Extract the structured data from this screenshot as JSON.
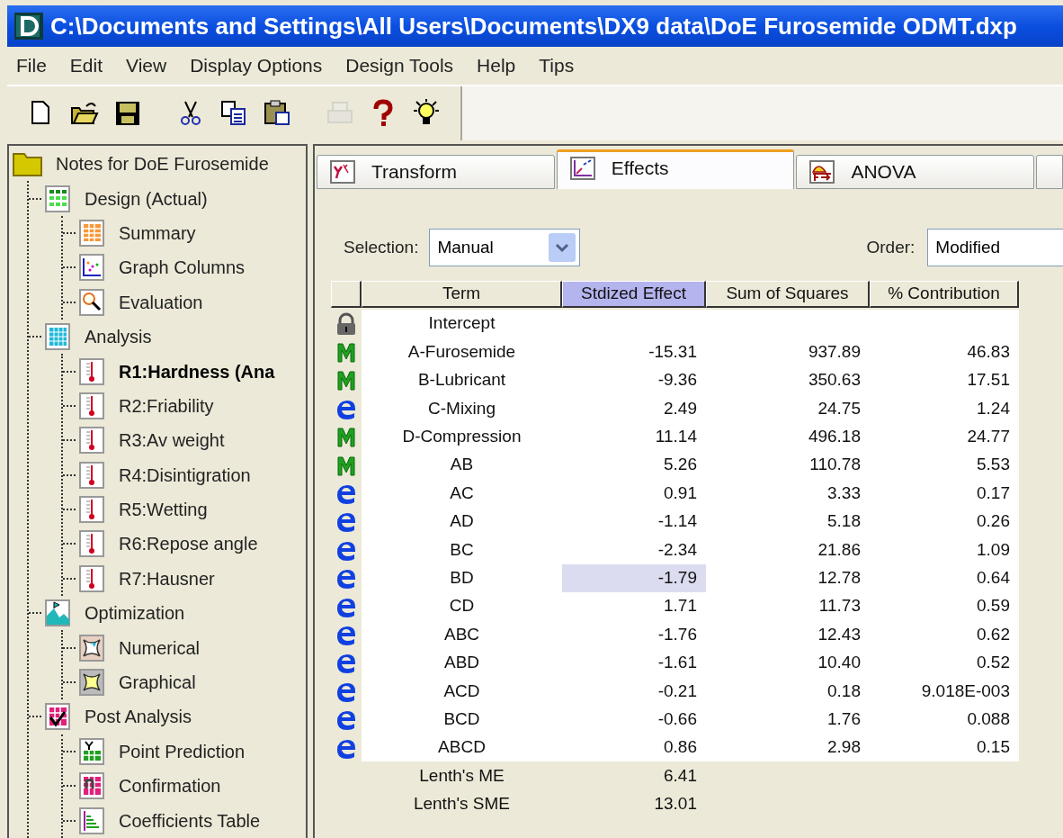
{
  "window": {
    "title": "C:\\Documents and Settings\\All Users\\Documents\\DX9 data\\DoE Furosemide ODMT.dxp"
  },
  "menu": [
    "File",
    "Edit",
    "View",
    "Display Options",
    "Design Tools",
    "Help",
    "Tips"
  ],
  "toolbar": [
    {
      "kind": "new",
      "disabled": false
    },
    {
      "kind": "open",
      "disabled": false
    },
    {
      "kind": "save",
      "disabled": false
    },
    {
      "kind": "sep"
    },
    {
      "kind": "cut",
      "disabled": false
    },
    {
      "kind": "copy",
      "disabled": false
    },
    {
      "kind": "paste",
      "disabled": false
    },
    {
      "kind": "sep"
    },
    {
      "kind": "print",
      "disabled": true
    },
    {
      "kind": "help",
      "disabled": false
    },
    {
      "kind": "tip",
      "disabled": false
    }
  ],
  "tree": [
    {
      "label": "Notes for DoE Furosemide",
      "kind": "folder",
      "selected": false,
      "children": [
        {
          "label": "Design (Actual)",
          "kind": "design",
          "selected": false,
          "children": [
            {
              "label": "Summary",
              "kind": "summary",
              "selected": false
            },
            {
              "label": "Graph Columns",
              "kind": "graph",
              "selected": false
            },
            {
              "label": "Evaluation",
              "kind": "evaluation",
              "selected": false
            }
          ]
        },
        {
          "label": "Analysis",
          "kind": "analysis",
          "selected": false,
          "children": [
            {
              "label": "R1:Hardness (Ana",
              "kind": "response",
              "selected": true
            },
            {
              "label": "R2:Friability",
              "kind": "response",
              "selected": false
            },
            {
              "label": "R3:Av weight",
              "kind": "response",
              "selected": false
            },
            {
              "label": "R4:Disintigration",
              "kind": "response",
              "selected": false
            },
            {
              "label": "R5:Wetting",
              "kind": "response",
              "selected": false
            },
            {
              "label": "R6:Repose angle",
              "kind": "response",
              "selected": false
            },
            {
              "label": "R7:Hausner",
              "kind": "response",
              "selected": false
            }
          ]
        },
        {
          "label": "Optimization",
          "kind": "optimization",
          "selected": false,
          "children": [
            {
              "label": "Numerical",
              "kind": "numerical",
              "selected": false
            },
            {
              "label": "Graphical",
              "kind": "graphical",
              "selected": false
            }
          ]
        },
        {
          "label": "Post Analysis",
          "kind": "post",
          "selected": false,
          "children": [
            {
              "label": "Point Prediction",
              "kind": "prediction",
              "selected": false
            },
            {
              "label": "Confirmation",
              "kind": "confirmation",
              "selected": false
            },
            {
              "label": "Coefficients Table",
              "kind": "coefficients",
              "selected": false
            }
          ]
        }
      ]
    }
  ],
  "tabs": [
    {
      "label": "Transform",
      "kind": "transform",
      "selected": false
    },
    {
      "label": "Effects",
      "kind": "effects",
      "selected": true
    },
    {
      "label": "ANOVA",
      "kind": "anova",
      "selected": false
    }
  ],
  "selection": {
    "label": "Selection:",
    "value": "Manual"
  },
  "order": {
    "label": "Order:",
    "value": "Modified"
  },
  "table": {
    "columns": [
      {
        "label": "Term",
        "selected": false
      },
      {
        "label": "Stdized Effect",
        "selected": true
      },
      {
        "label": "Sum of Squares",
        "selected": false
      },
      {
        "label": "% Contribution",
        "selected": false
      }
    ],
    "rows": [
      {
        "kind": "intercept",
        "term": "Intercept",
        "highlighted": false
      },
      {
        "kind": "model",
        "term": "A-Furosemide",
        "effect": "-15.31",
        "ss": "937.89",
        "contribution": "46.83",
        "highlighted": false
      },
      {
        "kind": "model",
        "term": "B-Lubricant",
        "effect": "-9.36",
        "ss": "350.63",
        "contribution": "17.51",
        "highlighted": false
      },
      {
        "kind": "error",
        "term": "C-Mixing",
        "effect": "2.49",
        "ss": "24.75",
        "contribution": "1.24",
        "highlighted": false
      },
      {
        "kind": "model",
        "term": "D-Compression",
        "effect": "11.14",
        "ss": "496.18",
        "contribution": "24.77",
        "highlighted": false
      },
      {
        "kind": "model",
        "term": "AB",
        "effect": "5.26",
        "ss": "110.78",
        "contribution": "5.53",
        "highlighted": false
      },
      {
        "kind": "error",
        "term": "AC",
        "effect": "0.91",
        "ss": "3.33",
        "contribution": "0.17",
        "highlighted": false
      },
      {
        "kind": "error",
        "term": "AD",
        "effect": "-1.14",
        "ss": "5.18",
        "contribution": "0.26",
        "highlighted": false
      },
      {
        "kind": "error",
        "term": "BC",
        "effect": "-2.34",
        "ss": "21.86",
        "contribution": "1.09",
        "highlighted": false
      },
      {
        "kind": "error",
        "term": "BD",
        "effect": "-1.79",
        "ss": "12.78",
        "contribution": "0.64",
        "highlighted": true
      },
      {
        "kind": "error",
        "term": "CD",
        "effect": "1.71",
        "ss": "11.73",
        "contribution": "0.59",
        "highlighted": false
      },
      {
        "kind": "error",
        "term": "ABC",
        "effect": "-1.76",
        "ss": "12.43",
        "contribution": "0.62",
        "highlighted": false
      },
      {
        "kind": "error",
        "term": "ABD",
        "effect": "-1.61",
        "ss": "10.40",
        "contribution": "0.52",
        "highlighted": false
      },
      {
        "kind": "error",
        "term": "ACD",
        "effect": "-0.21",
        "ss": "0.18",
        "contribution": "9.018E-003",
        "highlighted": false
      },
      {
        "kind": "error",
        "term": "BCD",
        "effect": "-0.66",
        "ss": "1.76",
        "contribution": "0.088",
        "highlighted": false
      },
      {
        "kind": "error",
        "term": "ABCD",
        "effect": "0.86",
        "ss": "2.98",
        "contribution": "0.15",
        "highlighted": false
      }
    ],
    "footer": [
      {
        "label": "Lenth's ME",
        "value": "6.41"
      },
      {
        "label": "Lenth's SME",
        "value": "13.01"
      }
    ]
  }
}
